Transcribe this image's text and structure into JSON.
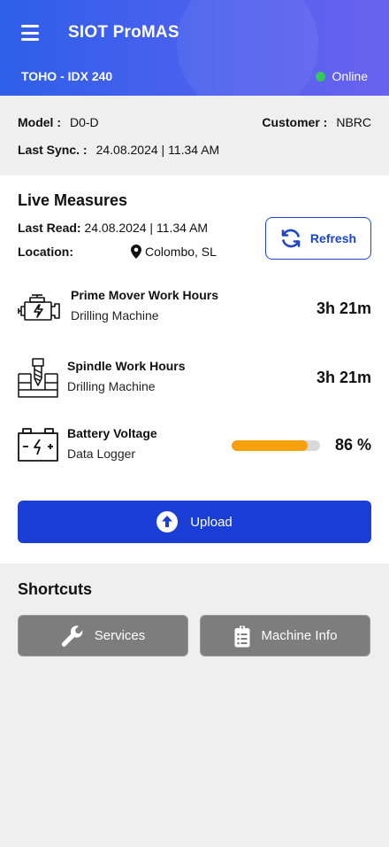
{
  "header": {
    "app_title": "SIOT ProMAS",
    "device_name": "TOHO - IDX 240",
    "status": "Online",
    "status_color": "#34c759"
  },
  "info": {
    "model_label": "Model :",
    "model_value": "D0-D",
    "customer_label": "Customer :",
    "customer_value": "NBRC",
    "sync_label": "Last Sync. :",
    "sync_value": "24.08.2024 | 11.34 AM"
  },
  "live": {
    "title": "Live Measures",
    "last_read_label": "Last Read:",
    "last_read_value": "24.08.2024 | 11.34 AM",
    "location_label": "Location:",
    "location_value": "Colombo, SL",
    "refresh_label": "Refresh",
    "measures": [
      {
        "title": "Prime Mover Work Hours",
        "subtitle": "Drilling Machine",
        "value": "3h 21m",
        "icon": "engine-icon"
      },
      {
        "title": "Spindle Work Hours",
        "subtitle": "Drilling Machine",
        "value": "3h 21m",
        "icon": "drill-icon"
      },
      {
        "title": "Battery Voltage",
        "subtitle": "Data Logger",
        "value": "86 %",
        "icon": "battery-icon",
        "level_percent": 86
      }
    ],
    "upload_label": "Upload"
  },
  "shortcuts": {
    "title": "Shortcuts",
    "items": [
      {
        "label": "Services",
        "icon": "wrench-icon"
      },
      {
        "label": "Machine Info",
        "icon": "clipboard-icon"
      }
    ]
  },
  "colors": {
    "header_gradient_start": "#2f5fe8",
    "header_gradient_end": "#6a62f0",
    "primary_button": "#1b3fd6",
    "battery_fill": "#f6a10c",
    "shortcut_button": "#7d7d7d"
  }
}
